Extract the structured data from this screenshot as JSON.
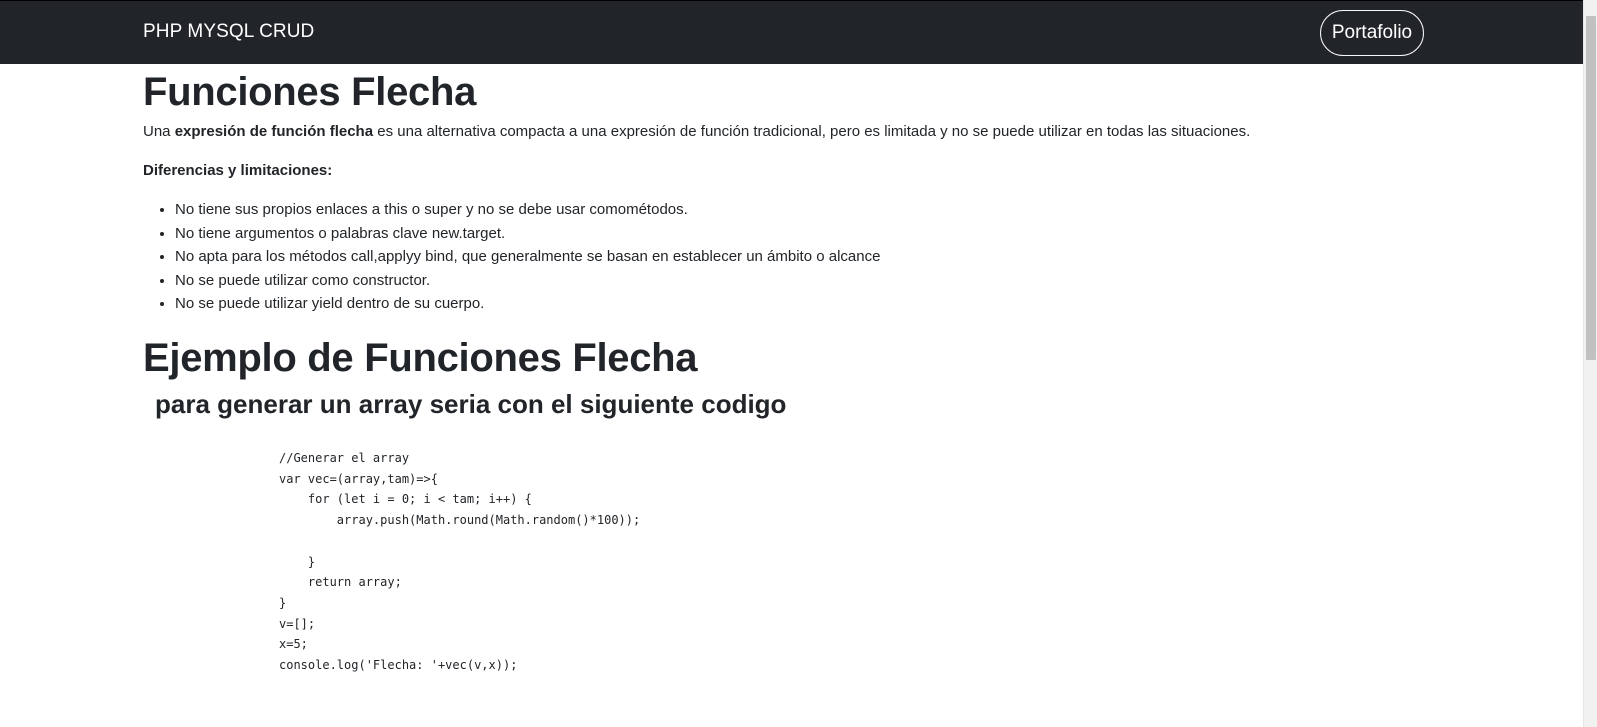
{
  "navbar": {
    "brand": "PHP MYSQL CRUD",
    "portafolio_label": "Portafolio"
  },
  "section1": {
    "title": "Funciones Flecha",
    "intro_prefix": "Una ",
    "intro_bold": "expresión de función flecha",
    "intro_suffix": " es una alternativa compacta a una expresión de función tradicional, pero es limitada y no se puede utilizar en todas las situaciones.",
    "differences_label": "Diferencias y limitaciones:",
    "limitations": [
      "No tiene sus propios enlaces a this o super y no se debe usar comométodos.",
      "No tiene argumentos o palabras clave new.target.",
      "No apta para los métodos call,applyy bind, que generalmente se basan en establecer un ámbito o alcance",
      "No se puede utilizar como constructor.",
      "No se puede utilizar yield dentro de su cuerpo."
    ]
  },
  "section2": {
    "title": "Ejemplo de Funciones Flecha",
    "subtitle": "para generar un array seria con el siguiente codigo",
    "code": "//Generar el array\nvar vec=(array,tam)=>{\n    for (let i = 0; i < tam; i++) {\n        array.push(Math.round(Math.random()*100));\n\n    }\n    return array;\n}\nv=[];\nx=5;\nconsole.log('Flecha: '+vec(v,x));"
  }
}
